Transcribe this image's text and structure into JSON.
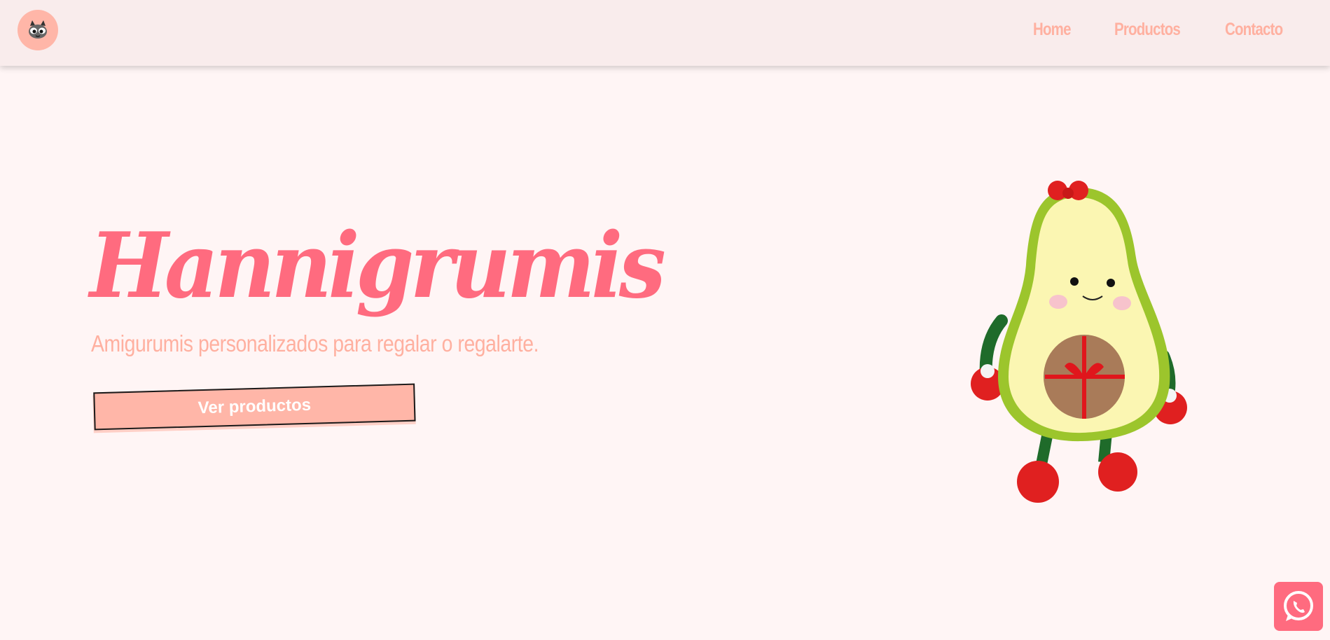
{
  "brand": {
    "logo_icon": "cat-icon",
    "accent": "#ff6b7f",
    "soft": "#ffb6a8",
    "background": "#fff5f5",
    "header_bg": "#f9ecec"
  },
  "nav": {
    "home": "Home",
    "products": "Productos",
    "contact": "Contacto"
  },
  "hero": {
    "title": "Hannigrumis",
    "subtitle": "Amigurumis personalizados para regalar o regalarte.",
    "cta": "Ver productos",
    "image_icon": "avocado-amigurumi-image"
  },
  "floating": {
    "whatsapp_icon": "whatsapp-icon"
  }
}
